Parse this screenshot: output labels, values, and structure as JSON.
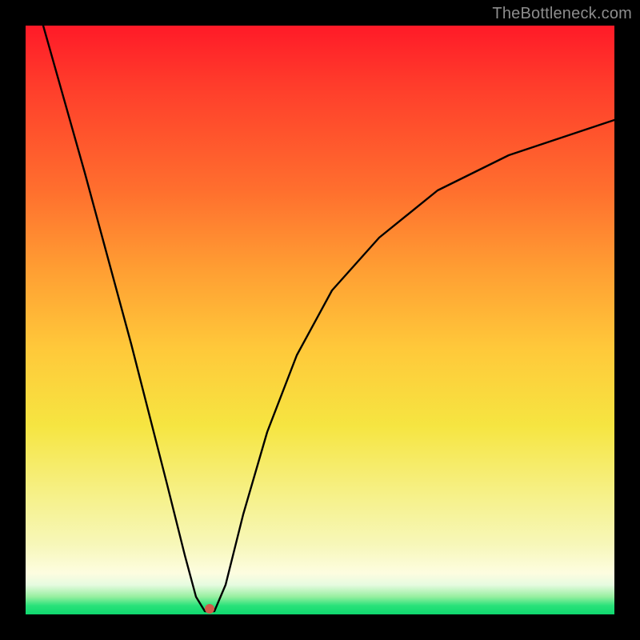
{
  "watermark": "TheBottleneck.com",
  "dot": {
    "x_pct": 31.2,
    "y_pct": 99.0
  },
  "chart_data": {
    "type": "line",
    "title": "",
    "xlabel": "",
    "ylabel": "",
    "xlim": [
      0,
      100
    ],
    "ylim": [
      0,
      100
    ],
    "series": [
      {
        "name": "curve",
        "x": [
          3,
          10,
          18,
          24,
          27,
          29,
          30.5,
          32,
          34,
          37,
          41,
          46,
          52,
          60,
          70,
          82,
          100
        ],
        "values": [
          100,
          75,
          46,
          22,
          10,
          3,
          0.5,
          0.5,
          5,
          17,
          31,
          44,
          55,
          64,
          72,
          78,
          84
        ]
      }
    ],
    "marker": {
      "x": 31.2,
      "y": 1.0
    },
    "background_gradient": [
      "#ff1a28",
      "#ffc93a",
      "#f6f18a",
      "#0fd86f"
    ]
  }
}
